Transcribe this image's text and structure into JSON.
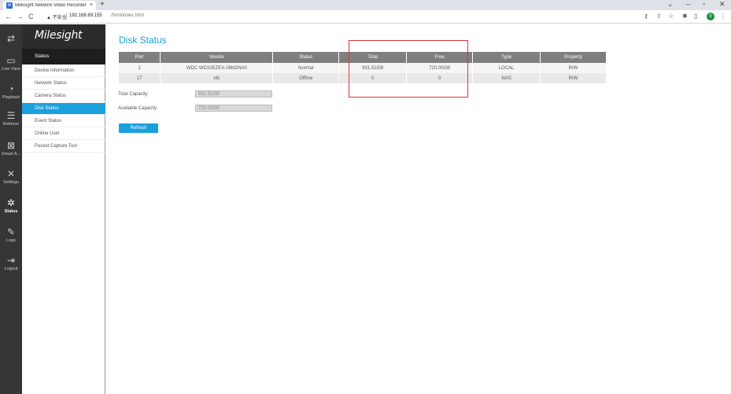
{
  "browser": {
    "tab_title": "Milesight Network Video Recorder",
    "tab_close": "×",
    "new_tab": "+",
    "url_warning": "▲ 不安全",
    "url_host": "192.168.69.155",
    "url_path": "/html/index.html",
    "profile_initial": "S"
  },
  "brand": {
    "name": "Milesight"
  },
  "iconbar": [
    {
      "label": "",
      "icon": "menu-toggle-icon",
      "glyph": "⇄"
    },
    {
      "label": "Live View",
      "icon": "live-view-icon",
      "glyph": "▭"
    },
    {
      "label": "Playback",
      "icon": "playback-icon",
      "glyph": "◔"
    },
    {
      "label": "Retrieve",
      "icon": "retrieve-icon",
      "glyph": "☰"
    },
    {
      "label": "Smart A...",
      "icon": "smart-analysis-icon",
      "glyph": "⊠"
    },
    {
      "label": "Settings",
      "icon": "settings-icon",
      "glyph": "✕"
    },
    {
      "label": "Status",
      "icon": "status-icon",
      "glyph": "✲"
    },
    {
      "label": "Logs",
      "icon": "logs-icon",
      "glyph": "✎"
    },
    {
      "label": "Logout",
      "icon": "logout-icon",
      "glyph": "⇥"
    }
  ],
  "sidebar": {
    "heading": "Status",
    "items": [
      {
        "label": "Device Information"
      },
      {
        "label": "Network Status"
      },
      {
        "label": "Camera Status"
      },
      {
        "label": "Disk Status"
      },
      {
        "label": "Event Status"
      },
      {
        "label": "Online User"
      },
      {
        "label": "Packet Capture Tool"
      }
    ],
    "active_index": 3
  },
  "main": {
    "title": "Disk Status",
    "columns": [
      "Port",
      "Vendor",
      "Status",
      "Total",
      "Free",
      "Type",
      "Property"
    ],
    "rows": [
      [
        "2",
        "WDC WD10EZEX-08M2NA0",
        "Normal",
        "931.51GB",
        "720.00GB",
        "LOCAL",
        "R/W"
      ],
      [
        "17",
        "nfs",
        "Offline",
        "0",
        "0",
        "NAS",
        "R/W"
      ]
    ],
    "total_capacity_label": "Total Capacity",
    "total_capacity_value": "931.51GB",
    "available_capacity_label": "Available Capacity",
    "available_capacity_value": "720.00GB",
    "refresh_label": "Refresh"
  },
  "colors": {
    "accent": "#1aa0dc",
    "highlight": "#e0343a",
    "table_header": "#7f7f7f"
  }
}
